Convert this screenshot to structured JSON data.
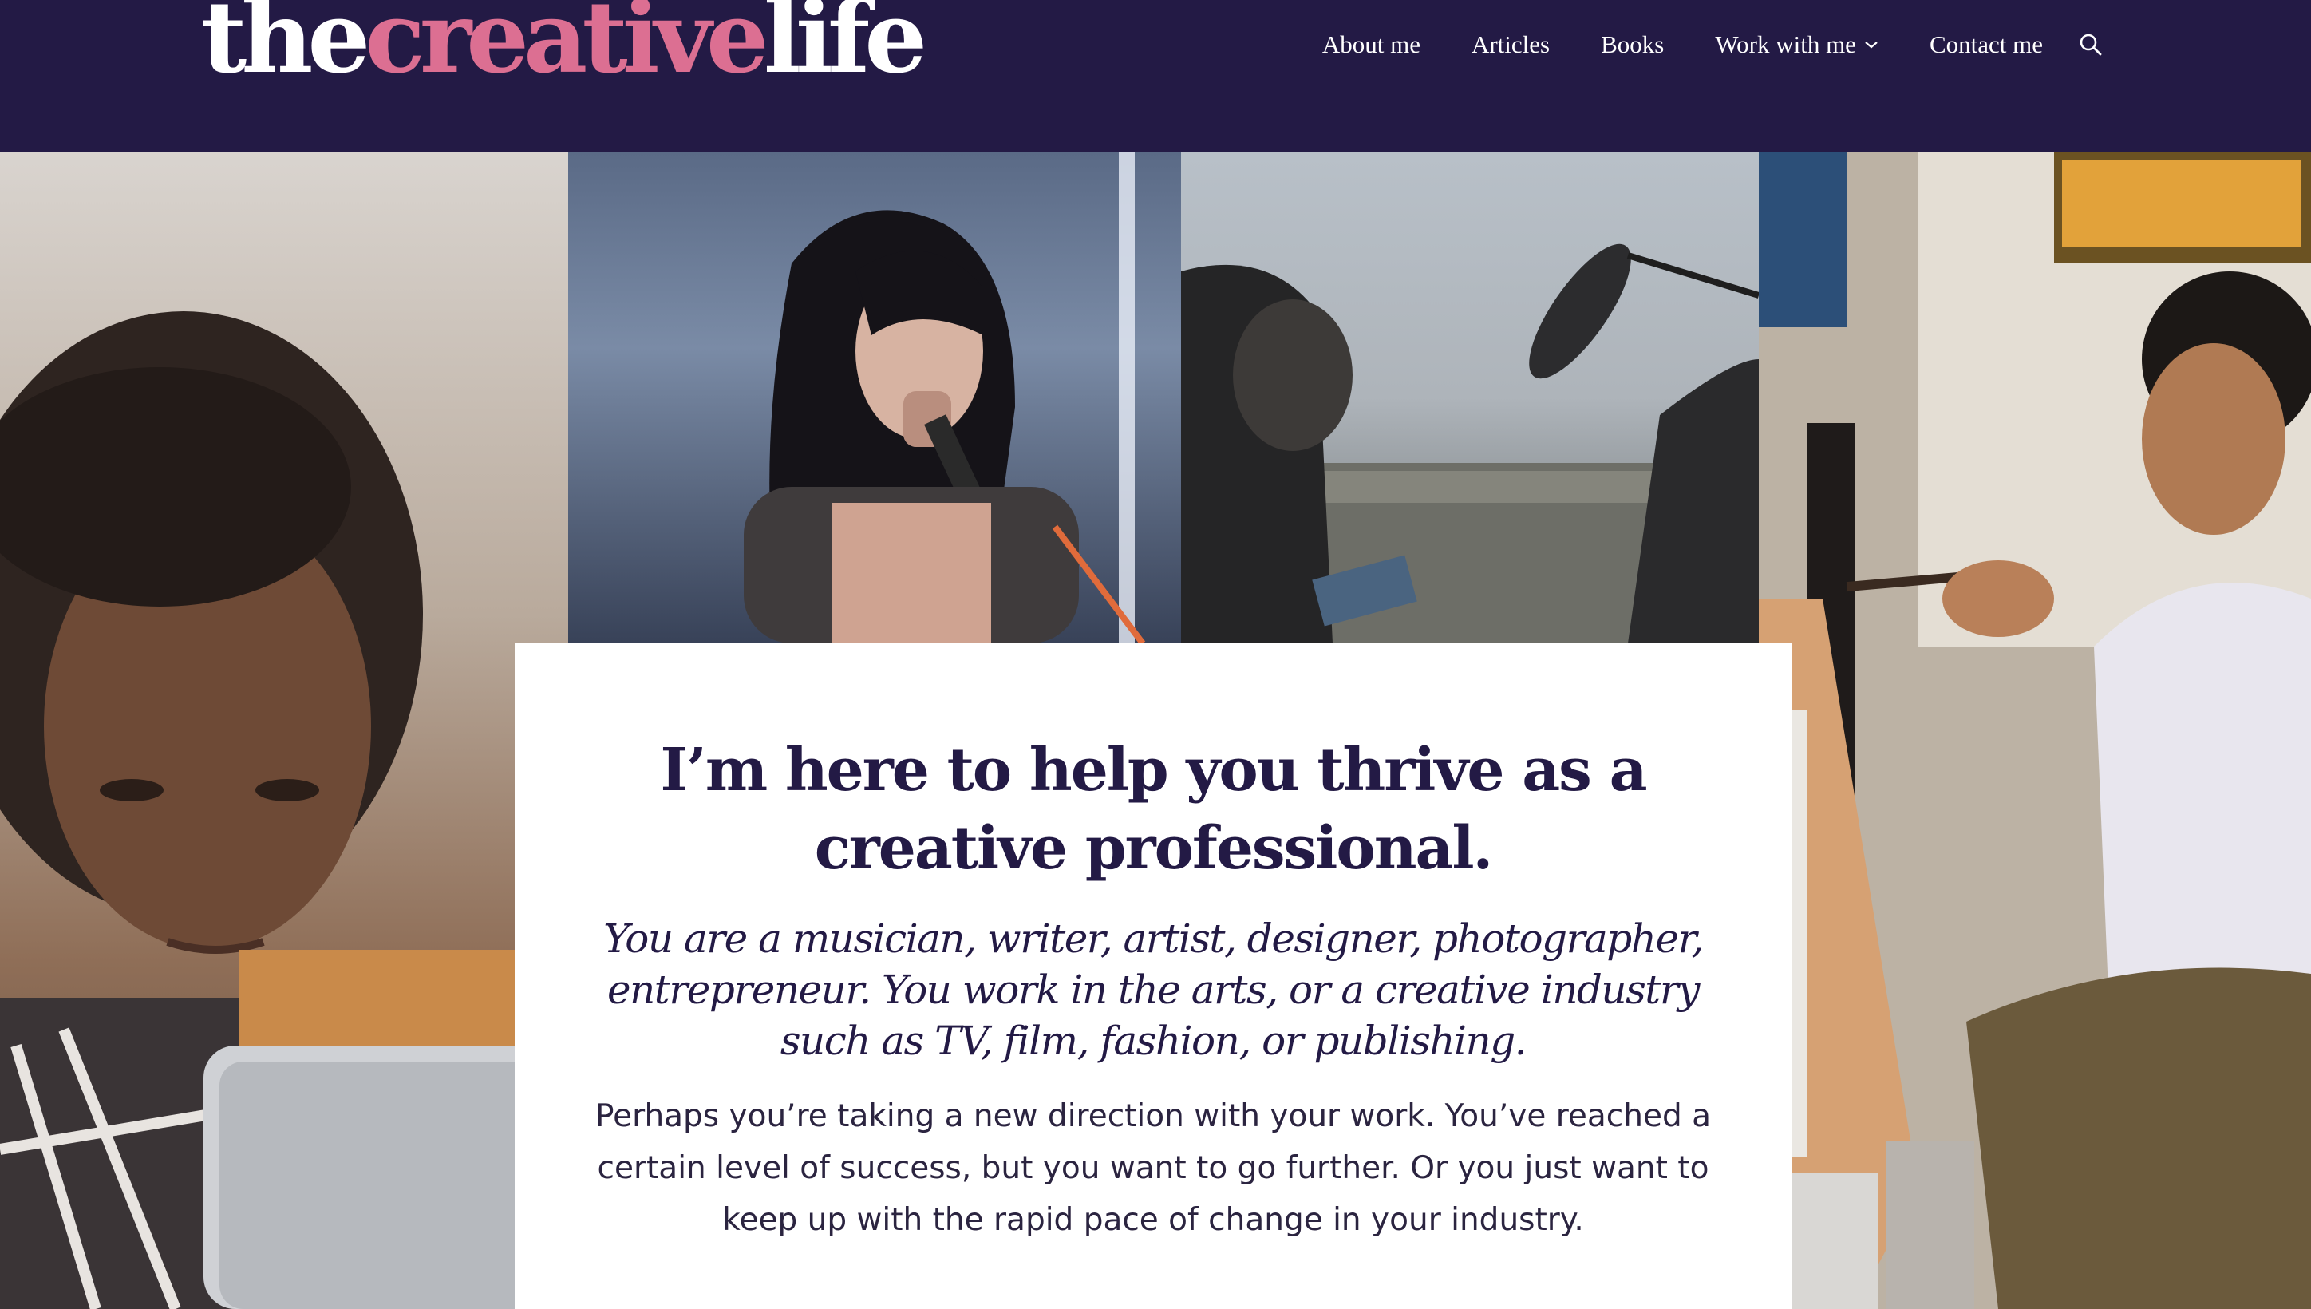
{
  "header": {
    "logo": {
      "part1": "the",
      "part2": "creative",
      "part3": "life"
    },
    "nav": {
      "about": "About me",
      "articles": "Articles",
      "books": "Books",
      "work": "Work with me",
      "contact": "Contact me"
    },
    "icons": {
      "search": "search-icon",
      "dropdown": "chevron-down-icon"
    }
  },
  "hero": {
    "photos": [
      "photo-woman-with-laptop",
      "photo-singer-with-microphone",
      "photo-film-crew-boom-mic",
      "photo-man-painting-canvas"
    ],
    "headline": "I’m here to help you thrive as a creative professional.",
    "subheadline": "You are a musician, writer, artist, designer, photographer, entrepreneur. You work in the arts, or a creative industry such as TV, film, fashion, or publishing.",
    "body": "Perhaps you’re taking a new direction with your work. You’ve reached a certain level of success, but you want to go further. Or you just want to keep up with the rapid pace of change in your industry."
  },
  "colors": {
    "header_bg": "#231a45",
    "accent_pink": "#dc6f92",
    "text_dark": "#231a45"
  }
}
